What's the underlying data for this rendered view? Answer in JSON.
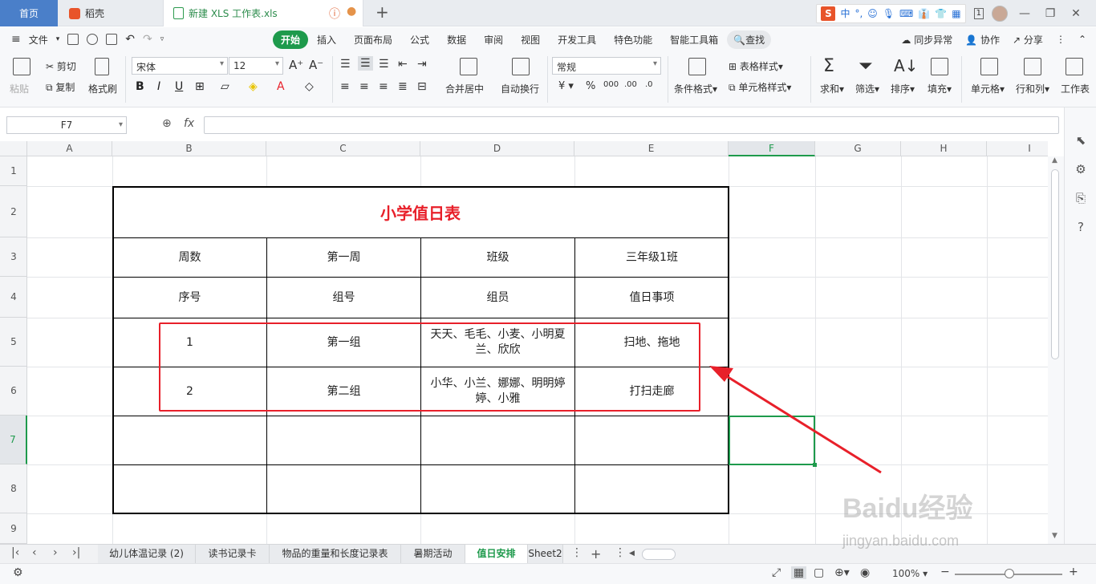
{
  "titlebar": {
    "tabs": [
      {
        "label": "首页"
      },
      {
        "label": "稻壳"
      },
      {
        "label": "新建 XLS 工作表.xls"
      }
    ],
    "new_tab": "+",
    "ime_label": "中",
    "page_num": "1"
  },
  "menubar": {
    "file_label": "文件",
    "items": [
      "开始",
      "插入",
      "页面布局",
      "公式",
      "数据",
      "审阅",
      "视图",
      "开发工具",
      "特色功能",
      "智能工具箱"
    ],
    "search_label": "查找",
    "sync_label": "同步异常",
    "collab_label": "协作",
    "share_label": "分享"
  },
  "ribbon": {
    "paste": "粘贴",
    "cut": "剪切",
    "copy": "复制",
    "format_painter": "格式刷",
    "font_name": "宋体",
    "font_size": "12",
    "merge_center": "合并居中",
    "wrap_text": "自动换行",
    "number_format": "常规",
    "cond_format": "条件格式",
    "table_style": "表格样式",
    "cell_style": "单元格样式",
    "sum": "求和",
    "filter": "筛选",
    "sort": "排序",
    "fill": "填充",
    "cell": "单元格",
    "row_col": "行和列",
    "worksheet": "工作表"
  },
  "formulabar": {
    "name_box": "F7",
    "fx": "fx",
    "value": ""
  },
  "grid": {
    "columns": [
      "A",
      "B",
      "C",
      "D",
      "E",
      "F",
      "G",
      "H",
      "I"
    ],
    "rows": [
      "1",
      "2",
      "3",
      "4",
      "5",
      "6",
      "7",
      "8",
      "9"
    ],
    "selected_cell": "F7"
  },
  "table": {
    "title": "小学值日表",
    "row3": [
      "周数",
      "第一周",
      "班级",
      "三年级1班"
    ],
    "row4": [
      "序号",
      "组号",
      "组员",
      "值日事项"
    ],
    "row5": [
      "1",
      "第一组",
      "天天、毛毛、小麦、小明夏兰、欣欣",
      "扫地、拖地"
    ],
    "row6": [
      "2",
      "第二组",
      "小华、小兰、娜娜、明明婷婷、小雅",
      "打扫走廊"
    ]
  },
  "sheets": [
    "幼儿体温记录 (2)",
    "读书记录卡",
    "物品的重量和长度记录表",
    "暑期活动",
    "值日安排",
    "Sheet2"
  ],
  "active_sheet": "值日安排",
  "status": {
    "zoom": "100%"
  },
  "watermark": {
    "brand": "Baidu经验",
    "url": "jingyan.baidu.com"
  },
  "colors": {
    "accent": "#1e9a4c",
    "title_red": "#e8202a",
    "highlight_red": "#e8202a"
  }
}
